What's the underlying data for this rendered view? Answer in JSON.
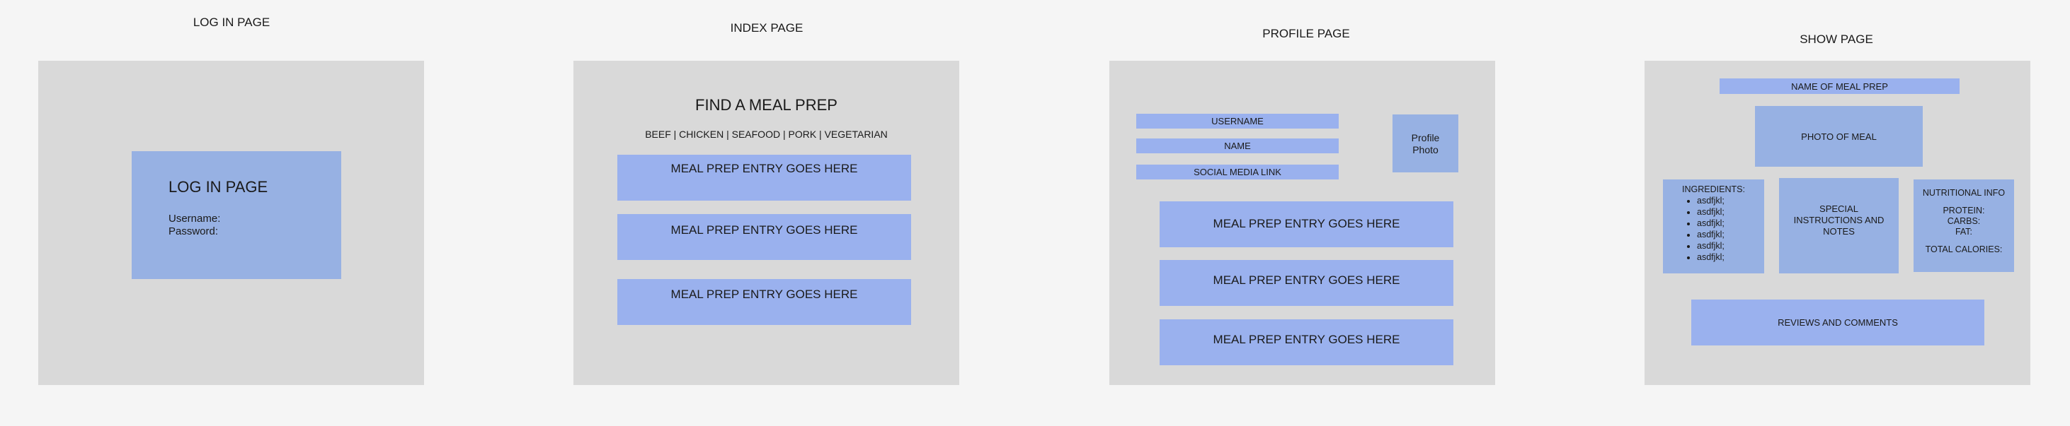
{
  "login": {
    "title": "LOG IN PAGE",
    "box_heading": "LOG IN PAGE",
    "username_label": "Username:",
    "password_label": "Password:"
  },
  "index": {
    "title": "INDEX PAGE",
    "heading": "FIND A MEAL PREP",
    "categories": "BEEF | CHICKEN | SEAFOOD | PORK | VEGETARIAN",
    "entries": [
      "MEAL PREP ENTRY GOES HERE",
      "MEAL PREP ENTRY GOES HERE",
      "MEAL PREP ENTRY GOES HERE"
    ]
  },
  "profile": {
    "title": "PROFILE PAGE",
    "username": "USERNAME",
    "name": "NAME",
    "social": "SOCIAL MEDIA LINK",
    "photo_line1": "Profile",
    "photo_line2": "Photo",
    "entries": [
      "MEAL PREP ENTRY GOES HERE",
      "MEAL PREP ENTRY GOES HERE",
      "MEAL PREP ENTRY GOES HERE"
    ]
  },
  "show": {
    "title": "SHOW PAGE",
    "meal_name": "NAME OF MEAL PREP",
    "photo": "PHOTO OF MEAL",
    "ingredients_label": "INGREDIENTS:",
    "ingredients": [
      "asdfjkl;",
      "asdfjkl;",
      "asdfjkl;",
      "asdfjkl;",
      "asdfjkl;",
      "asdfjkl;"
    ],
    "instructions_line1": "SPECIAL",
    "instructions_line2": "INSTRUCTIONS AND",
    "instructions_line3": "NOTES",
    "nutrition_label": "NUTRITIONAL INFO",
    "protein": "PROTEIN:",
    "carbs": "CARBS:",
    "fat": "FAT:",
    "total_calories": "TOTAL CALORIES:",
    "reviews": "REVIEWS AND COMMENTS"
  },
  "colors": {
    "background": "#f5f5f5",
    "frame": "#d9d9d9",
    "box_blue": "#97b1e3",
    "entry_blue": "#9ab1ee"
  }
}
